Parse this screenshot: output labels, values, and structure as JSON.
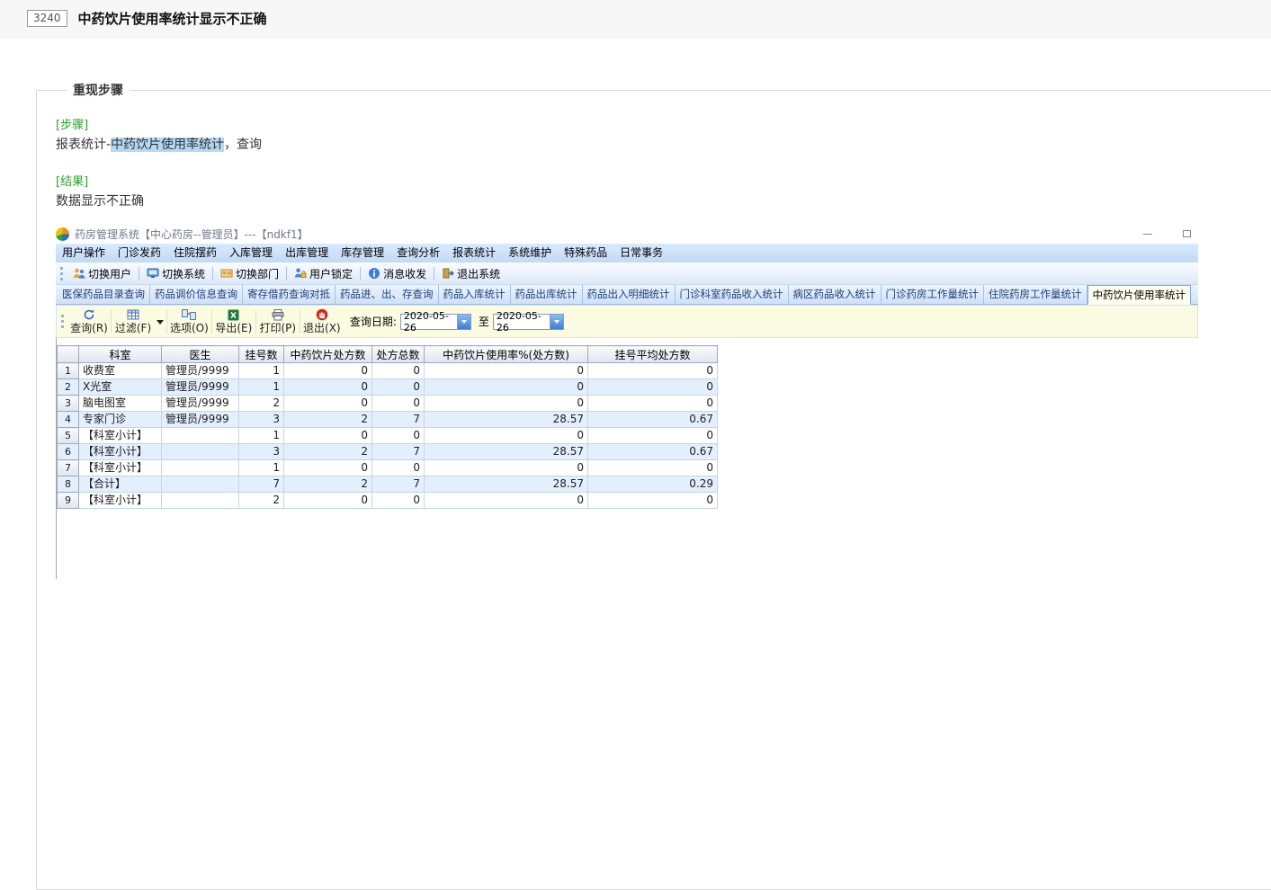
{
  "issue": {
    "id": "3240",
    "title": "中药饮片使用率统计显示不正确"
  },
  "repro": {
    "legend": "重现步骤",
    "steps_label": "[步骤]",
    "steps_prefix": "报表统计-",
    "steps_highlight": "中药饮片使用率统计",
    "steps_suffix": "，查询",
    "result_label": "[结果]",
    "result_text": "数据显示不正确"
  },
  "app": {
    "title": "药房管理系统【中心药房--管理员】---【ndkf1】",
    "titlebar_icons": [
      "app-logo-icon",
      "minimize-icon",
      "maximize-icon"
    ],
    "menu": [
      "用户操作",
      "门诊发药",
      "住院摆药",
      "入库管理",
      "出库管理",
      "库存管理",
      "查询分析",
      "报表统计",
      "系统维护",
      "特殊药品",
      "日常事务"
    ],
    "toolbar": [
      {
        "label": "切换用户",
        "icon": "switch-user-icon"
      },
      {
        "label": "切换系统",
        "icon": "switch-system-icon"
      },
      {
        "label": "切换部门",
        "icon": "switch-department-icon"
      },
      {
        "label": "用户锁定",
        "icon": "user-lock-icon"
      },
      {
        "label": "消息收发",
        "icon": "message-icon"
      },
      {
        "label": "退出系统",
        "icon": "exit-system-icon"
      }
    ],
    "tabs": [
      {
        "label": "医保药品目录查询",
        "active": false
      },
      {
        "label": "药品调价信息查询",
        "active": false
      },
      {
        "label": "寄存借药查询对抵",
        "active": false
      },
      {
        "label": "药品进、出、存查询",
        "active": false
      },
      {
        "label": "药品入库统计",
        "active": false
      },
      {
        "label": "药品出库统计",
        "active": false
      },
      {
        "label": "药品出入明细统计",
        "active": false
      },
      {
        "label": "门诊科室药品收入统计",
        "active": false
      },
      {
        "label": "病区药品收入统计",
        "active": false
      },
      {
        "label": "门诊药房工作量统计",
        "active": false
      },
      {
        "label": "住院药房工作量统计",
        "active": false
      },
      {
        "label": "中药饮片使用率统计",
        "active": true
      }
    ],
    "subtoolbar": {
      "buttons": [
        {
          "label": "查询(R)",
          "icon": "query-refresh-icon"
        },
        {
          "label": "过滤(F)",
          "icon": "filter-grid-icon",
          "dropdown": "filter-dropdown-icon"
        },
        {
          "label": "选项(O)",
          "icon": "options-icon"
        },
        {
          "label": "导出(E)",
          "icon": "export-excel-icon"
        },
        {
          "label": "打印(P)",
          "icon": "print-icon"
        },
        {
          "label": "退出(X)",
          "icon": "exit-stop-icon"
        }
      ],
      "date_label": "查询日期:",
      "date_from": "2020-05-26",
      "between_label": "至",
      "date_to": "2020-05-26",
      "combo_icon": "dropdown-arrow-icon"
    },
    "table": {
      "headers": [
        "科室",
        "医生",
        "挂号数",
        "中药饮片处方数",
        "处方总数",
        "中药饮片使用率%(处方数)",
        "挂号平均处方数"
      ],
      "rows": [
        {
          "num": "1",
          "dept": "收费室",
          "doctor": "管理员/9999",
          "values": [
            "1",
            "0",
            "0",
            "0",
            "0"
          ]
        },
        {
          "num": "2",
          "dept": "X光室",
          "doctor": "管理员/9999",
          "values": [
            "1",
            "0",
            "0",
            "0",
            "0"
          ]
        },
        {
          "num": "3",
          "dept": "脑电图室",
          "doctor": "管理员/9999",
          "values": [
            "2",
            "0",
            "0",
            "0",
            "0"
          ]
        },
        {
          "num": "4",
          "dept": "专家门诊",
          "doctor": "管理员/9999",
          "values": [
            "3",
            "2",
            "7",
            "28.57",
            "0.67"
          ]
        },
        {
          "num": "5",
          "dept": "【科室小计】",
          "doctor": "",
          "values": [
            "1",
            "0",
            "0",
            "0",
            "0"
          ]
        },
        {
          "num": "6",
          "dept": "【科室小计】",
          "doctor": "",
          "values": [
            "3",
            "2",
            "7",
            "28.57",
            "0.67"
          ]
        },
        {
          "num": "7",
          "dept": "【科室小计】",
          "doctor": "",
          "values": [
            "1",
            "0",
            "0",
            "0",
            "0"
          ]
        },
        {
          "num": "8",
          "dept": "【合计】",
          "doctor": "",
          "values": [
            "7",
            "2",
            "7",
            "28.57",
            "0.29"
          ]
        },
        {
          "num": "9",
          "dept": "【科室小计】",
          "doctor": "",
          "values": [
            "2",
            "0",
            "0",
            "0",
            "0"
          ]
        }
      ]
    }
  }
}
